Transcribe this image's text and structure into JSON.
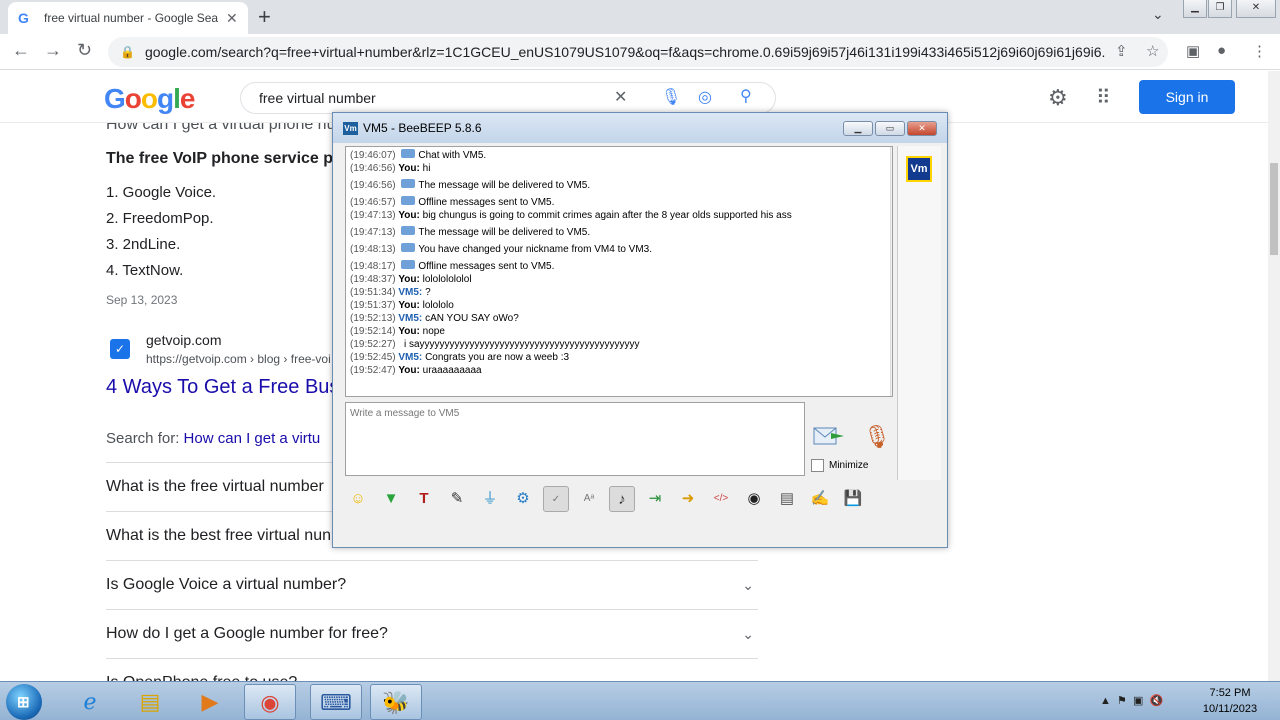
{
  "browser": {
    "tab_title": "free virtual number - Google Sea",
    "url": "google.com/search?q=free+virtual+number&rlz=1C1GCEU_enUS1079US1079&oq=f&aqs=chrome.0.69i59j69i57j46i131i199i433i465i512j69i60j69i61j69i6..."
  },
  "google": {
    "logo": "Google",
    "query": "free virtual number",
    "signin_label": "Sign in",
    "snippet_question": "How can I get a virtual phone nu",
    "snippet_bold": "The free VoIP phone service pro",
    "list": [
      "1. Google Voice.",
      "2. FreedomPop.",
      "3. 2ndLine.",
      "4. TextNow."
    ],
    "date": "Sep 13, 2023",
    "site_name": "getvoip.com",
    "site_url": "https://getvoip.com › blog › free-voi",
    "result_title": "4 Ways To Get a Free Bus",
    "search_for_prefix": "Search for:",
    "search_for_link": "How can I get a virtu",
    "paa": [
      "What is the free virtual number",
      "What is the best free virtual nun",
      "Is Google Voice a virtual number?",
      "How do I get a Google number for free?",
      "Is OpenPhone free to use?"
    ]
  },
  "beebeep": {
    "title": "VM5 - BeeBEEP 5.8.6",
    "avatar_label": "Vm",
    "chat": [
      {
        "ts": "(19:46:07)",
        "kind": "sys",
        "text": "Chat with VM5."
      },
      {
        "ts": "(19:46:56)",
        "kind": "you",
        "who": "You:",
        "text": "hi"
      },
      {
        "ts": "(19:46:56)",
        "kind": "sys",
        "text": "The message will be delivered to VM5."
      },
      {
        "ts": "(19:46:57)",
        "kind": "sys",
        "text": "Offline messages sent to VM5."
      },
      {
        "ts": "(19:47:13)",
        "kind": "you",
        "who": "You:",
        "text": "big chungus is going to commit crimes again after the 8 year olds supported his ass"
      },
      {
        "ts": "(19:47:13)",
        "kind": "sys",
        "text": "The message will be delivered to VM5."
      },
      {
        "ts": "(19:48:13)",
        "kind": "sys",
        "text": "You have changed your nickname from VM4 to VM3."
      },
      {
        "ts": "(19:48:17)",
        "kind": "sys",
        "text": "Offline messages sent to VM5."
      },
      {
        "ts": "(19:48:37)",
        "kind": "you",
        "who": "You:",
        "text": "lolololololol"
      },
      {
        "ts": "(19:51:34)",
        "kind": "vm5",
        "who": "VM5:",
        "text": "?"
      },
      {
        "ts": "(19:51:37)",
        "kind": "you",
        "who": "You:",
        "text": "lolololo"
      },
      {
        "ts": "(19:52:13)",
        "kind": "vm5",
        "who": "VM5:",
        "text": "cAN YOU SAY oWo?"
      },
      {
        "ts": "(19:52:14)",
        "kind": "you",
        "who": "You:",
        "text": "nope"
      },
      {
        "ts": "(19:52:27)",
        "kind": "plain",
        "text": "i sayyyyyyyyyyyyyyyyyyyyyyyyyyyyyyyyyyyyyyyyyyyy"
      },
      {
        "ts": "(19:52:45)",
        "kind": "vm5",
        "who": "VM5:",
        "text": "Congrats you are now a weeb :3"
      },
      {
        "ts": "(19:52:47)",
        "kind": "you",
        "who": "You:",
        "text": "uraaaaaaaaa"
      }
    ],
    "input_placeholder": "Write a message to VM5",
    "minimize_label": "Minimize",
    "toolbar": [
      "emoji-icon",
      "highlight-icon",
      "font-icon",
      "color-icon",
      "filter-icon",
      "settings-icon",
      "spellcheck-icon",
      "word-complete-icon",
      "music-icon",
      "send-file-icon",
      "send-folder-icon",
      "code-icon",
      "screenshot-icon",
      "archive-icon",
      "notes-icon",
      "save-icon"
    ]
  },
  "taskbar": {
    "time": "7:52 PM",
    "date": "10/11/2023"
  },
  "colors": {
    "google_blue": "#1a73e8",
    "link": "#1a0dab",
    "beebeep_vm5": "#1e5fb0"
  }
}
